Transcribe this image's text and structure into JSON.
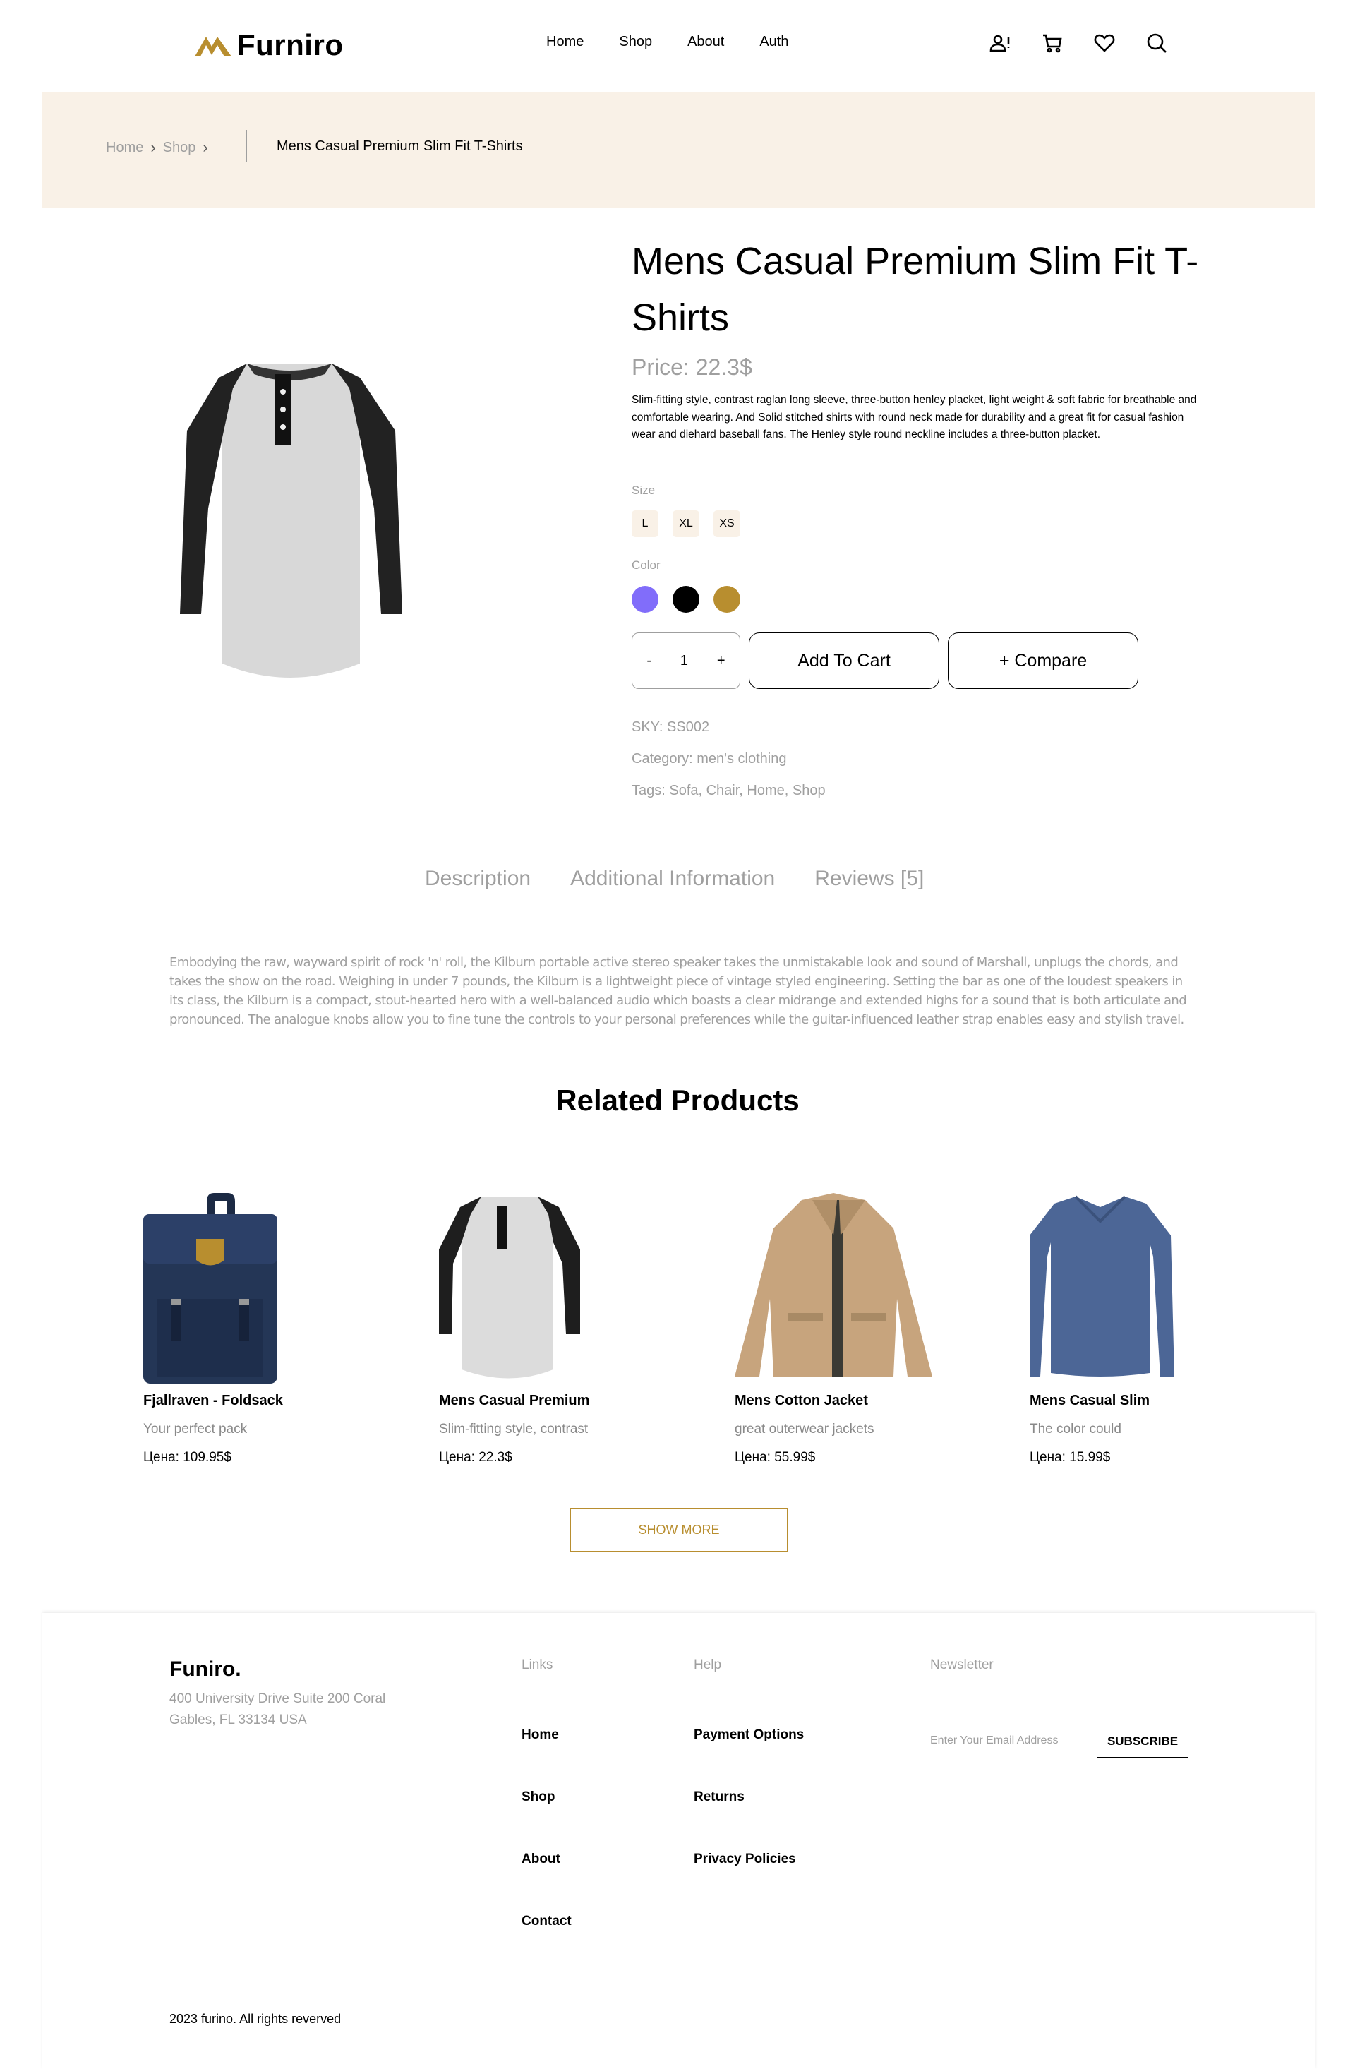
{
  "header": {
    "logo_text": "Furniro",
    "nav": [
      "Home",
      "Shop",
      "About",
      "Auth"
    ],
    "icons": [
      "account-alert-icon",
      "cart-icon",
      "heart-icon",
      "search-icon"
    ]
  },
  "breadcrumb": {
    "items": [
      "Home",
      "Shop"
    ],
    "current": "Mens Casual Premium Slim Fit T-Shirts"
  },
  "product": {
    "title": "Mens Casual Premium Slim Fit T-Shirts",
    "price": "Price: 22.3$",
    "description": "Slim-fitting style, contrast raglan long sleeve, three-button henley placket, light weight & soft fabric for breathable and comfortable wearing. And Solid stitched shirts with round neck made for durability and a great fit for casual fashion wear and diehard baseball fans. The Henley style round neckline includes a three-button placket.",
    "size_label": "Size",
    "sizes": [
      "L",
      "XL",
      "XS"
    ],
    "color_label": "Color",
    "colors": [
      "#816dfa",
      "#000000",
      "#b88e2f"
    ],
    "quantity": {
      "minus": "-",
      "value": "1",
      "plus": "+"
    },
    "add_to_cart": "Add To Cart",
    "compare": "+ Compare",
    "sku": "SKY: SS002",
    "category": "Category: men's clothing",
    "tags": "Tags: Sofa, Chair, Home, Shop"
  },
  "tabs": [
    "Description",
    "Additional Information",
    "Reviews [5]"
  ],
  "long_description": "Embodying the raw, wayward spirit of rock 'n' roll, the Kilburn portable active stereo speaker takes the unmistakable look and sound of Marshall, unplugs the chords, and takes the show on the road. Weighing in under 7 pounds, the Kilburn is a lightweight piece of vintage styled engineering. Setting the bar as one of the loudest speakers in its class, the Kilburn is a compact, stout-hearted hero with a well-balanced audio which boasts a clear midrange and extended highs for a sound that is both articulate and pronounced. The analogue knobs allow you to fine tune the controls to your personal preferences while the guitar-influenced leather strap enables easy and stylish travel.",
  "related": {
    "title": "Related Products",
    "products": [
      {
        "name": "Fjallraven - Foldsack",
        "subtitle": "Your perfect pack",
        "price": "Цена: 109.95$"
      },
      {
        "name": "Mens Casual Premium",
        "subtitle": "Slim-fitting style, contrast",
        "price": "Цена: 22.3$"
      },
      {
        "name": "Mens Cotton Jacket",
        "subtitle": "great outerwear jackets",
        "price": "Цена: 55.99$"
      },
      {
        "name": "Mens Casual Slim",
        "subtitle": "The color could",
        "price": "Цена: 15.99$"
      }
    ],
    "show_more": "SHOW MORE"
  },
  "footer": {
    "brand": "Funiro.",
    "address": "400 University Drive Suite 200 Coral Gables, FL 33134 USA",
    "links_heading": "Links",
    "links": [
      "Home",
      "Shop",
      "About",
      "Contact"
    ],
    "help_heading": "Help",
    "help": [
      "Payment Options",
      "Returns",
      "Privacy Policies"
    ],
    "newsletter_heading": "Newsletter",
    "email_placeholder": "Enter Your Email Address",
    "subscribe": "SUBSCRIBE",
    "copyright": "2023 furino. All rights reverved"
  },
  "accent_color": "#b88e2f"
}
